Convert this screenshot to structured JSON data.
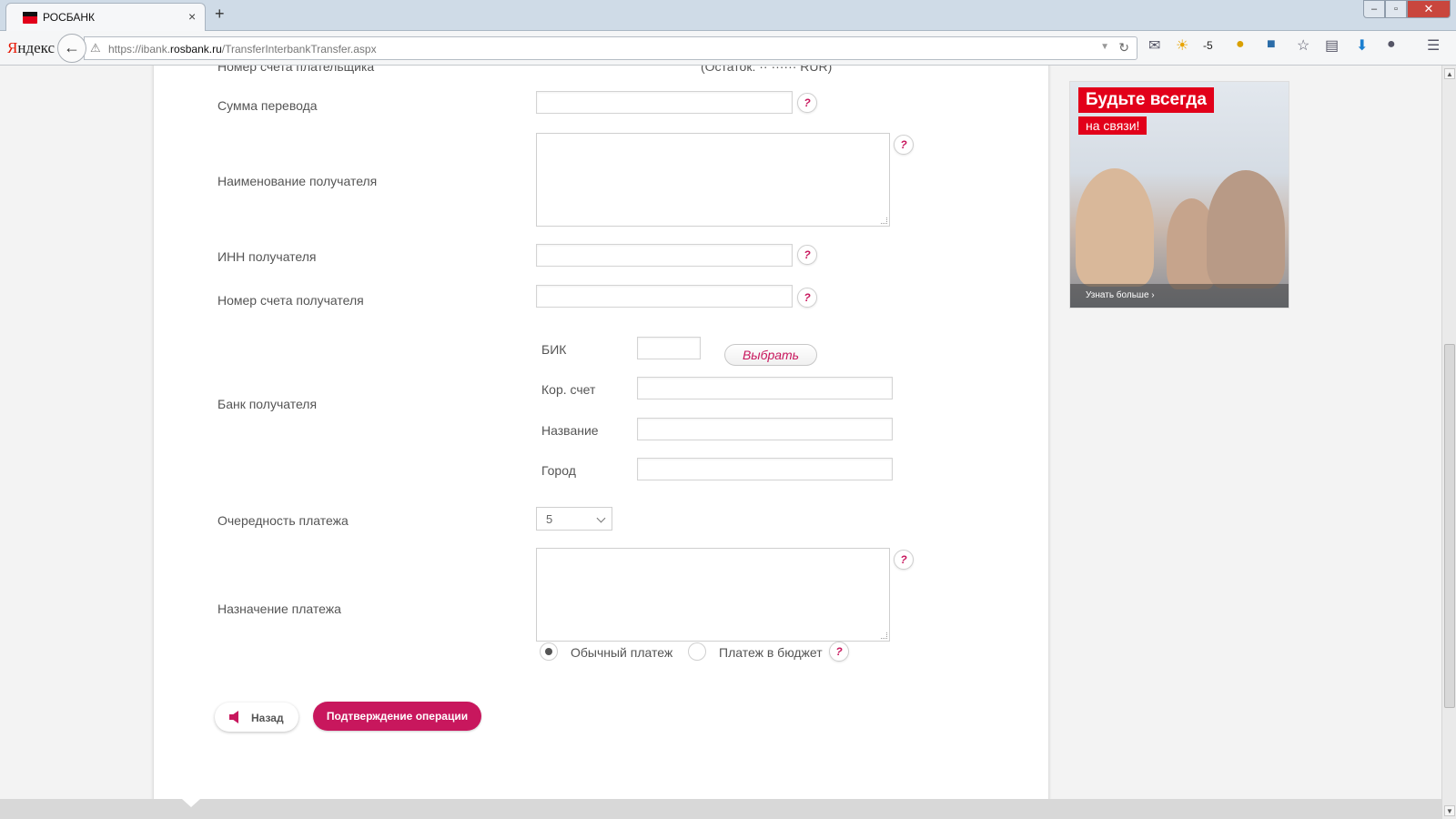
{
  "browser": {
    "tab_title": "РОСБАНК",
    "tab_close": "×",
    "new_tab": "+",
    "yandex_y": "Я",
    "yandex_rest": "ндекс",
    "url_prefix": "https://ibank.",
    "url_domain": "rosbank.ru",
    "url_path": "/TransferInterbankTransfer.aspx",
    "weather_temp": "-5"
  },
  "form": {
    "payer_account_label": "Номер счета плательщика",
    "payer_balance": "(Остаток: ·· ······ RUR)",
    "amount_label": "Сумма перевода",
    "recipient_name_label": "Наименование получателя",
    "recipient_inn_label": "ИНН получателя",
    "recipient_account_label": "Номер счета получателя",
    "bank_label": "Банк получателя",
    "bik_label": "БИК",
    "select_button": "Выбрать",
    "corr_account_label": "Кор. счет",
    "bank_name_label": "Название",
    "city_label": "Город",
    "priority_label": "Очередность платежа",
    "priority_value": "5",
    "purpose_label": "Назначение платежа",
    "radio_regular": "Обычный платеж",
    "radio_budget": "Платеж в бюджет",
    "help": "?",
    "back_button": "Назад",
    "confirm_button": "Подтверждение операции"
  },
  "ad": {
    "headline1": "Будьте всегда",
    "headline2": "на связи!",
    "link": "Узнать больше ›"
  },
  "colors": {
    "accent": "#c8175d",
    "brand_red": "#e2001a"
  }
}
